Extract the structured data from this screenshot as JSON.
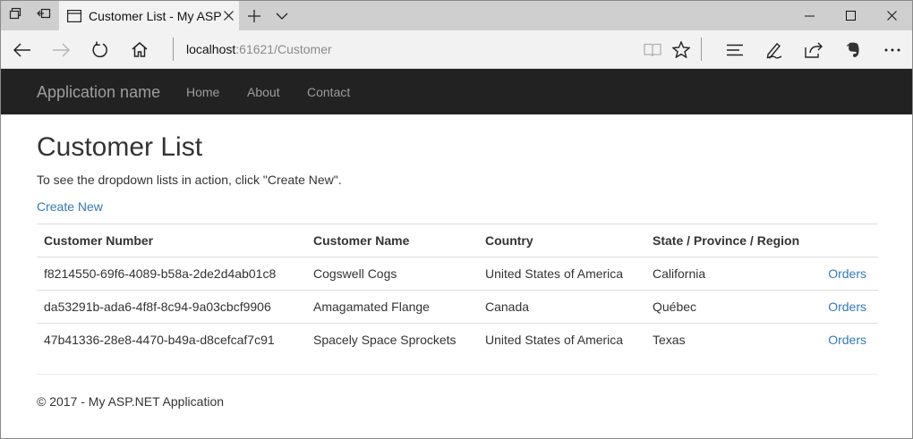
{
  "browser": {
    "tab_title": "Customer List - My ASP",
    "address_host": "localhost",
    "address_rest": ":61621/Customer"
  },
  "site": {
    "brand": "Application name",
    "nav": [
      "Home",
      "About",
      "Contact"
    ]
  },
  "page": {
    "title": "Customer List",
    "intro": "To see the dropdown lists in action, click \"Create New\".",
    "create_link": "Create New"
  },
  "table": {
    "headers": [
      "Customer Number",
      "Customer Name",
      "Country",
      "State / Province / Region"
    ],
    "rows": [
      {
        "number": "f8214550-69f6-4089-b58a-2de2d4ab01c8",
        "name": "Cogswell Cogs",
        "country": "United States of America",
        "region": "California",
        "link": "Orders"
      },
      {
        "number": "da53291b-ada6-4f8f-8c94-9a03cbcf9906",
        "name": "Amagamated Flange",
        "country": "Canada",
        "region": "Québec",
        "link": "Orders"
      },
      {
        "number": "47b41336-28e8-4470-b49a-d8cefcaf7c91",
        "name": "Spacely Space Sprockets",
        "country": "United States of America",
        "region": "Texas",
        "link": "Orders"
      }
    ]
  },
  "footer": {
    "text": "© 2017 - My ASP.NET Application"
  },
  "colors": {
    "navbar_bg": "#222222",
    "link": "#337ab7",
    "tabbar_bg": "#cfcfcf"
  },
  "icons": [
    "tab-preview-icon",
    "set-aside-tabs-icon",
    "page-icon",
    "close-icon",
    "new-tab-icon",
    "chevron-down-icon",
    "minimize-icon",
    "maximize-icon",
    "window-close-icon",
    "back-icon",
    "forward-icon",
    "refresh-icon",
    "home-icon",
    "reading-view-icon",
    "favorite-star-icon",
    "hub-icon",
    "notes-pen-icon",
    "share-icon",
    "evernote-icon",
    "more-icon"
  ]
}
